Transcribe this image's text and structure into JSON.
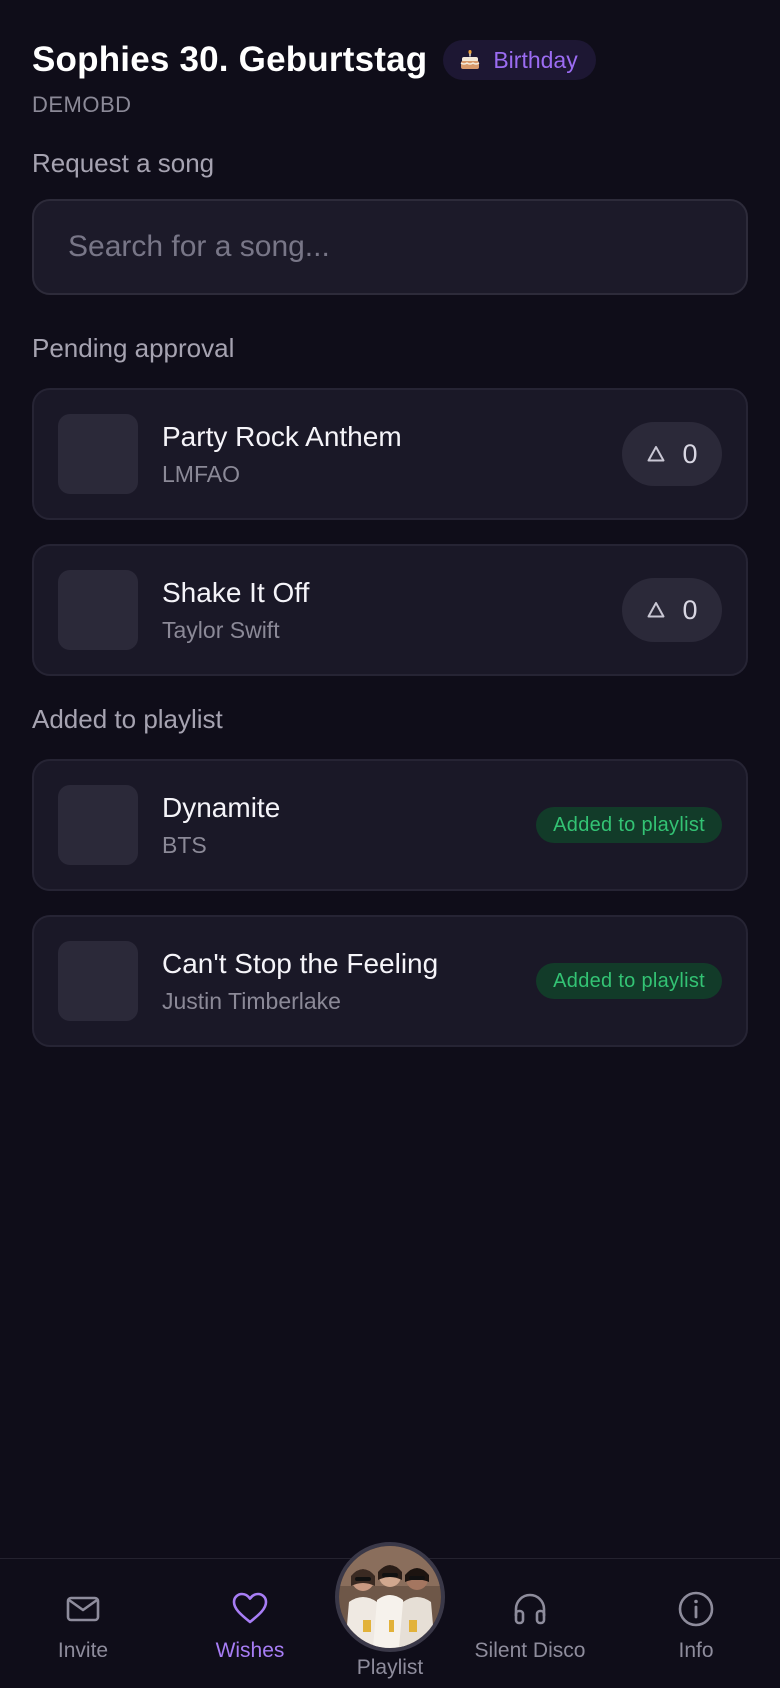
{
  "header": {
    "title": "Sophies 30. Geburtstag",
    "badge_label": "Birthday",
    "badge_icon": "birthday-cake-icon",
    "event_code": "DEMOBD"
  },
  "request": {
    "label": "Request a song",
    "search_placeholder": "Search for a song..."
  },
  "pending": {
    "label": "Pending approval",
    "songs": [
      {
        "title": "Party Rock Anthem",
        "artist": "LMFAO",
        "votes": "0"
      },
      {
        "title": "Shake It Off",
        "artist": "Taylor Swift",
        "votes": "0"
      }
    ]
  },
  "added": {
    "label": "Added to playlist",
    "songs": [
      {
        "title": "Dynamite",
        "artist": "BTS",
        "status": "Added to playlist"
      },
      {
        "title": "Can't Stop the Feeling",
        "artist": "Justin Timberlake",
        "status": "Added to playlist"
      }
    ]
  },
  "nav": {
    "items": [
      {
        "label": "Invite",
        "icon": "envelope-icon",
        "active": false
      },
      {
        "label": "Wishes",
        "icon": "heart-icon",
        "active": true
      },
      {
        "label": "Playlist",
        "icon": "album-cover-disc",
        "active": false
      },
      {
        "label": "Silent Disco",
        "icon": "headphones-icon",
        "active": false
      },
      {
        "label": "Info",
        "icon": "info-circle-icon",
        "active": false
      }
    ]
  },
  "colors": {
    "background": "#0f0d19",
    "card": "#1a1827",
    "accent": "#a77df5",
    "badge_text": "#9b6cf2",
    "added_green": "#33c374",
    "added_green_bg": "#123b29"
  }
}
